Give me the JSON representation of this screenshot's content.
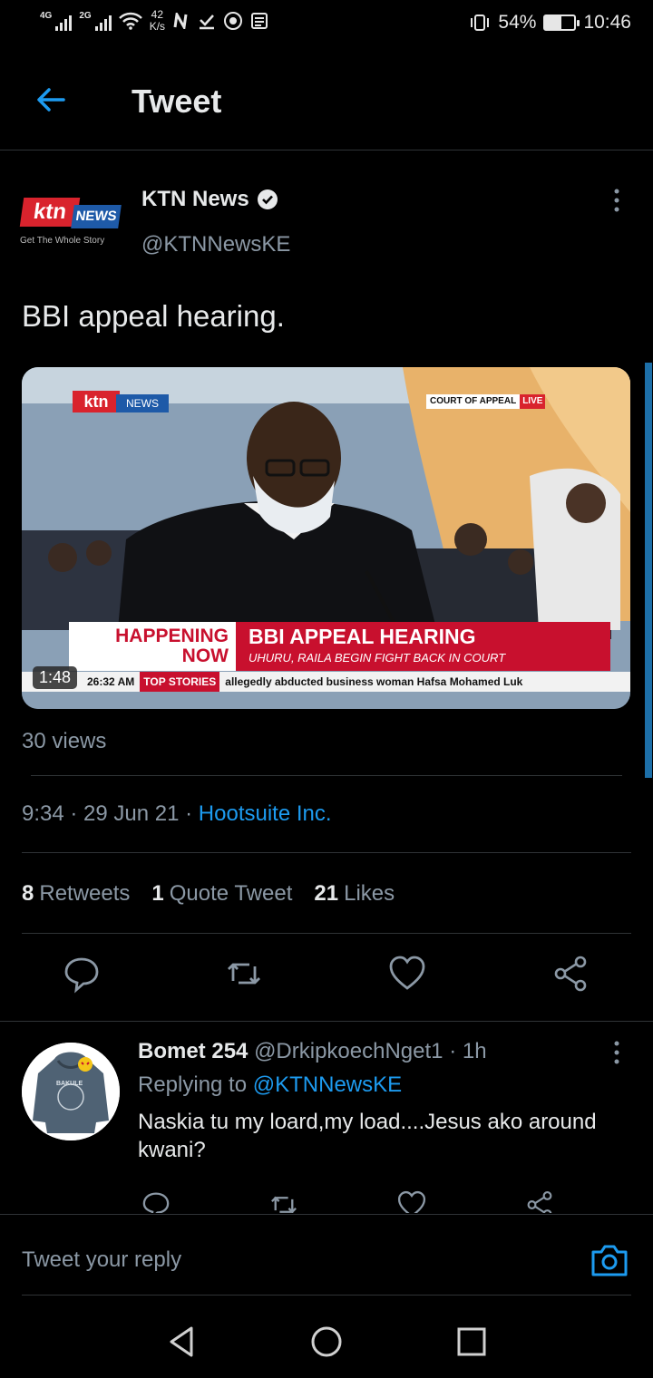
{
  "status_bar": {
    "net1": "4G",
    "net2": "2G",
    "speed_value": "42",
    "speed_unit": "K/s",
    "battery_percent": "54%",
    "battery_level": 0.54,
    "time": "10:46"
  },
  "header": {
    "title": "Tweet"
  },
  "tweet": {
    "author_name": "KTN News",
    "author_handle": "@KTNNewsKE",
    "avatar": {
      "brand": "ktn",
      "badge": "NEWS",
      "tagline": "Get The Whole Story"
    },
    "text": "BBI appeal hearing.",
    "video": {
      "logo_text": "ktn",
      "logo_badge": "NEWS",
      "court_label": "COURT OF APPEAL",
      "live_label": "LIVE",
      "happening_line1": "HAPPENING",
      "happening_line2": "NOW",
      "headline": "BBI APPEAL HEARING",
      "subheadline": "UHURU, RAILA BEGIN FIGHT BACK IN COURT",
      "ticker_time": "26:32 AM",
      "ticker_tag": "TOP STORIES",
      "ticker_text": "allegedly abducted business woman Hafsa Mohamed Luk",
      "duration": "1:48"
    },
    "views": "30 views",
    "time": "9:34 · 29 Jun 21 · ",
    "source": "Hootsuite Inc.",
    "stats": {
      "retweets_count": "8",
      "retweets_label": "Retweets",
      "quotes_count": "1",
      "quotes_label": "Quote Tweet",
      "likes_count": "21",
      "likes_label": "Likes"
    }
  },
  "reply": {
    "name": "Bomet 254",
    "handle": "@DrkipkoechNget1",
    "time": "· 1h",
    "replying_prefix": "Replying to ",
    "replying_to": "@KTNNewsKE",
    "text": "Naskia tu my loard,my load....Jesus ako around kwani?",
    "avatar_text": "BAKULE"
  },
  "compose": {
    "placeholder": "Tweet your reply"
  },
  "colors": {
    "accent": "#1d9bf0",
    "background": "#000000",
    "muted": "#8b98a5"
  },
  "icons": [
    "back-arrow-icon",
    "verified-icon",
    "more-vertical-icon",
    "reply-icon",
    "retweet-icon",
    "like-icon",
    "share-icon",
    "camera-icon",
    "nav-back-icon",
    "nav-home-icon",
    "nav-recents-icon"
  ]
}
